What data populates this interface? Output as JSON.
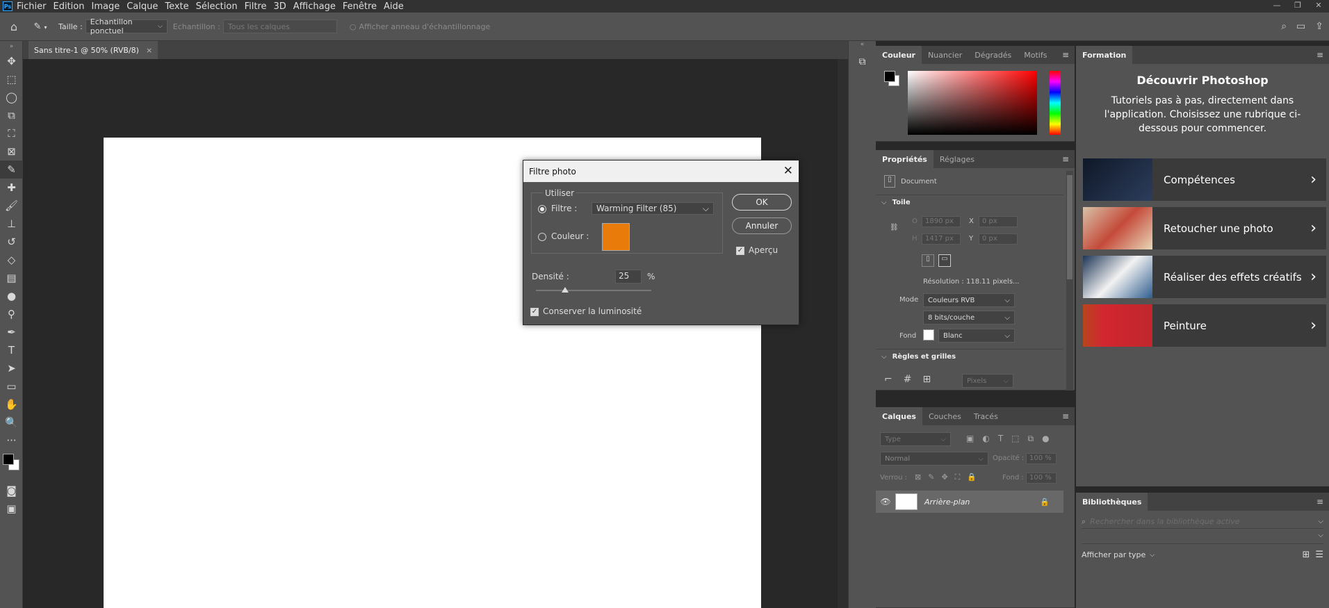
{
  "menubar": {
    "logo": "Ps",
    "items": [
      "Fichier",
      "Edition",
      "Image",
      "Calque",
      "Texte",
      "Sélection",
      "Filtre",
      "3D",
      "Affichage",
      "Fenêtre",
      "Aide"
    ]
  },
  "options": {
    "taille_label": "Taille :",
    "taille_value": "Echantillon ponctuel",
    "echantillon_label": "Echantillon :",
    "echantillon_value": "Tous les calques",
    "ring_label": "Afficher anneau d'échantillonnage"
  },
  "document": {
    "tab_title": "Sans titre-1 @ 50% (RVB/8)"
  },
  "color_panel": {
    "tabs": [
      "Couleur",
      "Nuancier",
      "Dégradés",
      "Motifs"
    ],
    "fg_color": "#000000",
    "bg_color": "#ffffff",
    "hue_color": "#ff0000"
  },
  "props_panel": {
    "tabs": [
      "Propriétés",
      "Réglages"
    ],
    "doc_label": "Document",
    "toile_label": "Toile",
    "w_label": "O",
    "w_value": "1890 px",
    "x_label": "X",
    "x_value": "0 px",
    "h_label": "H",
    "h_value": "1417 px",
    "y_label": "Y",
    "y_value": "0 px",
    "resolution": "Résolution : 118.11 pixels...",
    "mode_label": "Mode",
    "mode_value": "Couleurs RVB",
    "bits_value": "8 bits/couche",
    "fond_label": "Fond",
    "fond_value": "Blanc",
    "regles_label": "Règles et grilles",
    "units_value": "Pixels"
  },
  "layers_panel": {
    "tabs": [
      "Calques",
      "Couches",
      "Tracés"
    ],
    "filter_placeholder": "Type",
    "blend_mode": "Normal",
    "opacity_label": "Opacité :",
    "opacity_value": "100 %",
    "lock_label": "Verrou :",
    "fill_label": "Fond :",
    "fill_value": "100 %",
    "layer_name": "Arrière-plan"
  },
  "formation": {
    "tab": "Formation",
    "heading": "Découvrir Photoshop",
    "subtitle": "Tutoriels pas à pas, directement dans l'application. Choisissez une rubrique ci-dessous pour commencer.",
    "cards": [
      {
        "title": "Compétences",
        "thumb_color": "#1e2a3f"
      },
      {
        "title": "Retoucher une photo",
        "thumb_color": "#c9a27a"
      },
      {
        "title": "Réaliser des effets créatifs",
        "thumb_color": "#2f4f6f"
      },
      {
        "title": "Peinture",
        "thumb_color": "#c0272d"
      }
    ]
  },
  "bibliotheques": {
    "tab": "Bibliothèques",
    "search_placeholder": "Rechercher dans la bibliothèque active",
    "view_label": "Afficher par type"
  },
  "dialog": {
    "title": "Filtre photo",
    "group_label": "Utiliser",
    "filtre_label": "Filtre :",
    "filtre_value": "Warming Filter (85)",
    "couleur_label": "Couleur :",
    "couleur_swatch": "#e87b0a",
    "ok_label": "OK",
    "cancel_label": "Annuler",
    "apercu_label": "Aperçu",
    "densite_label": "Densité :",
    "densite_value": "25",
    "densite_unit": "%",
    "densite_fraction": 0.25,
    "luminosite_label": "Conserver la luminosité"
  }
}
